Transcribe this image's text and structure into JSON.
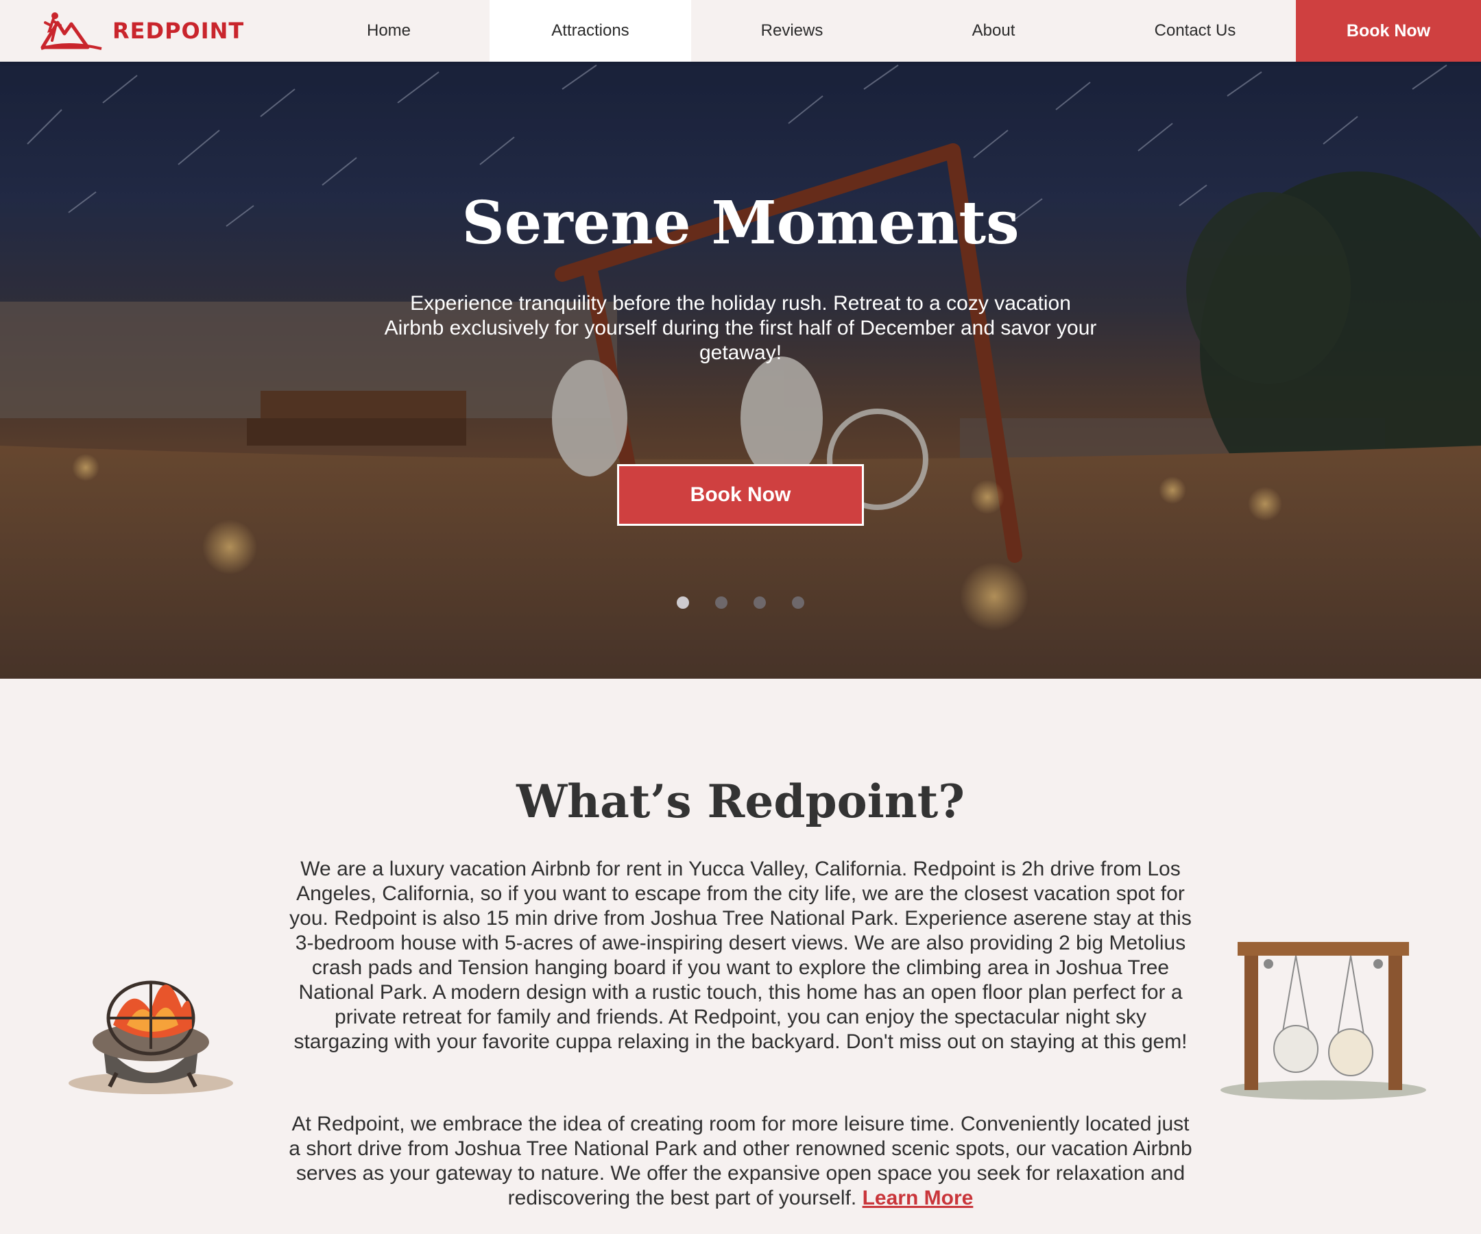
{
  "brand": {
    "name": "REDPOINT",
    "color": "#c9252c"
  },
  "nav": {
    "items": [
      {
        "label": "Home"
      },
      {
        "label": "Attractions"
      },
      {
        "label": "Reviews"
      },
      {
        "label": "About"
      },
      {
        "label": "Contact Us"
      }
    ],
    "active_index": 1,
    "cta_label": "Book Now"
  },
  "hero": {
    "title": "Serene Moments",
    "subtitle": "Experience tranquility before the holiday rush. Retreat to a cozy vacation Airbnb exclusively for yourself during the first half of December and savor your getaway!",
    "button_label": "Book Now",
    "slides_total": 4,
    "active_slide": 1
  },
  "about": {
    "title": "What’s Redpoint?",
    "paragraph1": "We are a luxury vacation Airbnb for rent in Yucca Valley, California. Redpoint is 2h drive from Los Angeles, California, so if you want to escape from the city life, we are the closest vacation spot for you. Redpoint is also 15 min drive from Joshua Tree National Park. Experience aserene stay at this 3-bedroom house with 5-acres of awe-inspiring desert views. We are also providing 2 big Metolius crash pads and Tension hanging board if you want to explore the climbing area in Joshua Tree National Park. A modern design with a rustic touch, this home has an open floor plan perfect for a private retreat for family and friends. At Redpoint, you can enjoy the spectacular night sky stargazing with your favorite cuppa relaxing in the backyard. Don't miss out on staying at this gem!",
    "paragraph2": "At Redpoint, we embrace the idea of creating room for more leisure time. Conveniently located just a short drive from Joshua Tree National Park and other renowned scenic spots, our vacation Airbnb serves as your gateway to nature. We offer the expansive open space you seek for relaxation and rediscovering the best part of yourself.",
    "learn_more_label": "Learn More"
  },
  "icons": {
    "logo": "mountain-climber-logo",
    "left_illustration": "fire-pit-icon",
    "right_illustration": "hammock-swing-icon"
  },
  "colors": {
    "accent": "#cf4040",
    "background": "#f6f1f0",
    "text": "#333333"
  }
}
